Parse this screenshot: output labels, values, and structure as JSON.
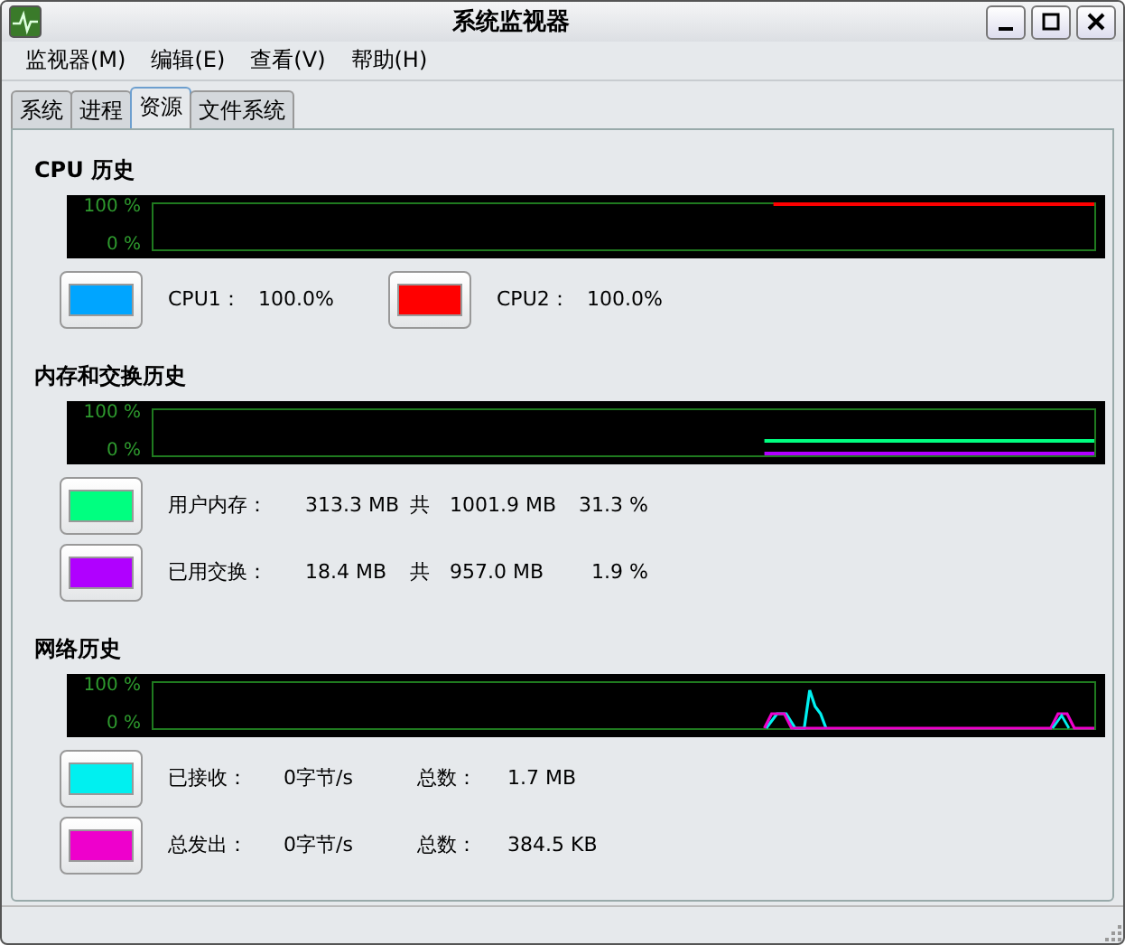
{
  "window": {
    "title": "系统监视器"
  },
  "menu": [
    {
      "label": "监视器(M)"
    },
    {
      "label": "编辑(E)"
    },
    {
      "label": "查看(V)"
    },
    {
      "label": "帮助(H)"
    }
  ],
  "tabs": [
    {
      "label": "系统",
      "selected": false
    },
    {
      "label": "进程",
      "selected": false
    },
    {
      "label": "资源",
      "selected": true
    },
    {
      "label": "文件系统",
      "selected": false
    }
  ],
  "sections": [
    {
      "title": "CPU 历史",
      "kind": "cpu",
      "graph": {
        "labels": [
          "100 %",
          "0 %"
        ]
      },
      "rows": [
        [
          {
            "color": "#00a5ff",
            "texts": [
              "CPU1：",
              "100.0%"
            ]
          },
          {
            "color": "#ff0000",
            "texts": [
              "CPU2：",
              "100.0%"
            ]
          }
        ]
      ]
    },
    {
      "title": "内存和交换历史",
      "kind": "memory",
      "graph": {
        "labels": [
          "100 %",
          "0 %"
        ]
      },
      "rows": [
        [
          {
            "color": "#00ff80",
            "texts": [
              "用户内存：",
              "313.3 MB",
              "共",
              "1001.9 MB",
              "31.3 %"
            ]
          }
        ],
        [
          {
            "color": "#b000ff",
            "texts": [
              "已用交换：",
              "18.4 MB",
              "共",
              "957.0 MB",
              "1.9 %"
            ]
          }
        ]
      ]
    },
    {
      "title": "网络历史",
      "kind": "network",
      "graph": {
        "labels": [
          "100 %",
          "0 %"
        ]
      },
      "rows": [
        [
          {
            "color": "#00f0f0",
            "texts": [
              "已接收：",
              "0字节/s",
              "总数：",
              "1.7 MB"
            ]
          }
        ],
        [
          {
            "color": "#ee00cc",
            "texts": [
              "总发出：",
              "0字节/s",
              "总数：",
              "384.5 KB"
            ]
          }
        ]
      ]
    }
  ]
}
